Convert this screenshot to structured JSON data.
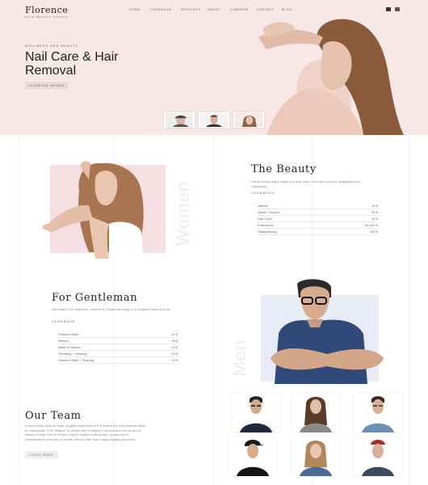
{
  "brand": {
    "logo": "Florence",
    "tagline": "HAIR BEAUTY STUDIO"
  },
  "nav": {
    "items": [
      "HOME",
      "LOOKBOOK",
      "SERVICES",
      "ABOUT",
      "CAREERS",
      "CONTACT",
      "BLOG"
    ]
  },
  "social": [
    "youtube-icon",
    "facebook-icon"
  ],
  "hero": {
    "eyebrow": "WELLNESS AND BEAUTY",
    "title_line1": "Nail Care & Hair",
    "title_line2": "Removal",
    "button": "LOOKBOOK WOMEN",
    "thumbnails": [
      "woman-with-hat",
      "man-portrait",
      "woman-hair"
    ]
  },
  "women": {
    "vertical_label": "Women",
    "title": "The Beauty",
    "description": "We do everything to make you look good, from hair coloring, straightening to extensions.",
    "lookbook": "LOOKBOOK",
    "prices": [
      {
        "name": "Haircut",
        "price": "25 €"
      },
      {
        "name": "Wash + Haircut",
        "price": "30 €"
      },
      {
        "name": "Hair Color",
        "price": "45 €"
      },
      {
        "name": "Extensions",
        "price": "60-120 €"
      },
      {
        "name": "Straightening",
        "price": "150 €"
      }
    ]
  },
  "men": {
    "vertical_label": "Men",
    "title": "For Gentleman",
    "description": "Men want to be styled too, whether it a beard trimming or a complete wash and cut.",
    "lookbook": "LOOKBOOK",
    "prices": [
      {
        "name": "Shorten Sides",
        "price": "12 €"
      },
      {
        "name": "Haircut",
        "price": "18 €"
      },
      {
        "name": "Wash & Haircut",
        "price": "25 €"
      },
      {
        "name": "Trimming + Shaving",
        "price": "20 €"
      },
      {
        "name": "Shorten Sides + Shaving",
        "price": "15 €"
      }
    ]
  },
  "team": {
    "title": "Our Team",
    "description": "Lorem ipsum dolor sit amet, sagittis vestibulum sed. Posuere est duis molestie tellus ut malesuada. Proin tristique ut ultrices sed et aliquet. Hac tincidunt nec ac dui ut. Massa in vitae velit, ut et enim nisl sit. Dictum nulla tempor in eget lorem, reprehenderit commodo ut mattis. Nec ac ante eros magna sagittis ipsum nec.",
    "button": "LEARN MORE",
    "members": [
      "man-glasses",
      "woman-brunette",
      "man-glasses-blue",
      "man-cap",
      "woman-blonde",
      "man-beanie"
    ]
  }
}
